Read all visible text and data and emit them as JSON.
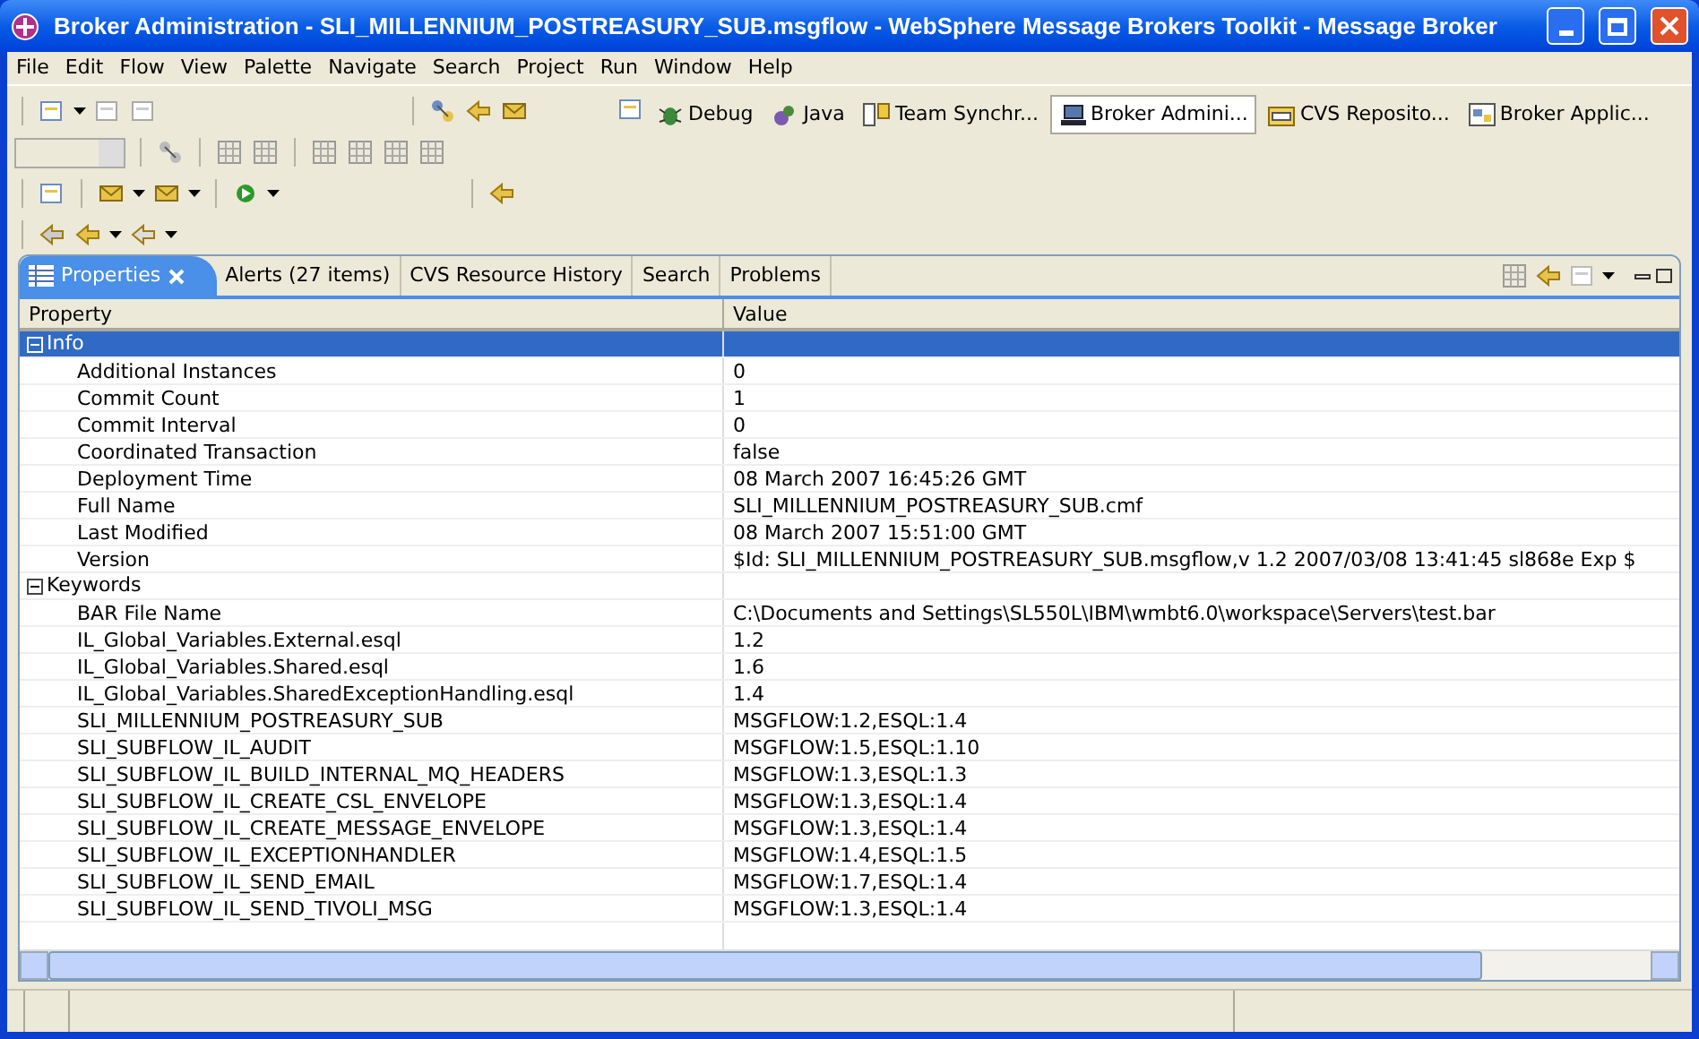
{
  "window": {
    "title": "Broker Administration - SLI_MILLENNIUM_POSTREASURY_SUB.msgflow - WebSphere Message Brokers Toolkit - Message Broker"
  },
  "menu": [
    "File",
    "Edit",
    "Flow",
    "View",
    "Palette",
    "Navigate",
    "Search",
    "Project",
    "Run",
    "Window",
    "Help"
  ],
  "perspectives": [
    {
      "label": "Debug",
      "selected": false
    },
    {
      "label": "Java",
      "selected": false
    },
    {
      "label": "Team Synchr...",
      "selected": false
    },
    {
      "label": "Broker Admini...",
      "selected": true
    },
    {
      "label": "CVS Reposito...",
      "selected": false
    },
    {
      "label": "Broker Applic...",
      "selected": false
    }
  ],
  "view_tabs": [
    {
      "label": "Properties",
      "selected": true
    },
    {
      "label": "Alerts (27 items)",
      "selected": false
    },
    {
      "label": "CVS Resource History",
      "selected": false
    },
    {
      "label": "Search",
      "selected": false
    },
    {
      "label": "Problems",
      "selected": false
    }
  ],
  "table": {
    "columns": [
      "Property",
      "Value"
    ],
    "groups": [
      {
        "label": "Info",
        "expanded": true,
        "selected": true,
        "rows": [
          {
            "property": "Additional Instances",
            "value": "0"
          },
          {
            "property": "Commit Count",
            "value": "1"
          },
          {
            "property": "Commit Interval",
            "value": "0"
          },
          {
            "property": "Coordinated Transaction",
            "value": "false"
          },
          {
            "property": "Deployment Time",
            "value": "08 March 2007 16:45:26 GMT"
          },
          {
            "property": "Full Name",
            "value": "SLI_MILLENNIUM_POSTREASURY_SUB.cmf"
          },
          {
            "property": "Last Modified",
            "value": "08 March 2007 15:51:00 GMT"
          },
          {
            "property": "Version",
            "value": "$Id: SLI_MILLENNIUM_POSTREASURY_SUB.msgflow,v 1.2 2007/03/08 13:41:45 sl868e Exp $"
          }
        ]
      },
      {
        "label": "Keywords",
        "expanded": true,
        "selected": false,
        "rows": [
          {
            "property": "BAR File Name",
            "value": "C:\\Documents and Settings\\SL550L\\IBM\\wmbt6.0\\workspace\\Servers\\test.bar"
          },
          {
            "property": "IL_Global_Variables.External.esql",
            "value": "1.2"
          },
          {
            "property": "IL_Global_Variables.Shared.esql",
            "value": "1.6"
          },
          {
            "property": "IL_Global_Variables.SharedExceptionHandling.esql",
            "value": "1.4"
          },
          {
            "property": "SLI_MILLENNIUM_POSTREASURY_SUB",
            "value": "MSGFLOW:1.2,ESQL:1.4"
          },
          {
            "property": "SLI_SUBFLOW_IL_AUDIT",
            "value": "MSGFLOW:1.5,ESQL:1.10"
          },
          {
            "property": "SLI_SUBFLOW_IL_BUILD_INTERNAL_MQ_HEADERS",
            "value": "MSGFLOW:1.3,ESQL:1.3"
          },
          {
            "property": "SLI_SUBFLOW_IL_CREATE_CSL_ENVELOPE",
            "value": "MSGFLOW:1.3,ESQL:1.4"
          },
          {
            "property": "SLI_SUBFLOW_IL_CREATE_MESSAGE_ENVELOPE",
            "value": "MSGFLOW:1.3,ESQL:1.4"
          },
          {
            "property": "SLI_SUBFLOW_IL_EXCEPTIONHANDLER",
            "value": "MSGFLOW:1.4,ESQL:1.5"
          },
          {
            "property": "SLI_SUBFLOW_IL_SEND_EMAIL",
            "value": "MSGFLOW:1.7,ESQL:1.4"
          },
          {
            "property": "SLI_SUBFLOW_IL_SEND_TIVOLI_MSG",
            "value": "MSGFLOW:1.3,ESQL:1.4"
          }
        ]
      }
    ]
  }
}
